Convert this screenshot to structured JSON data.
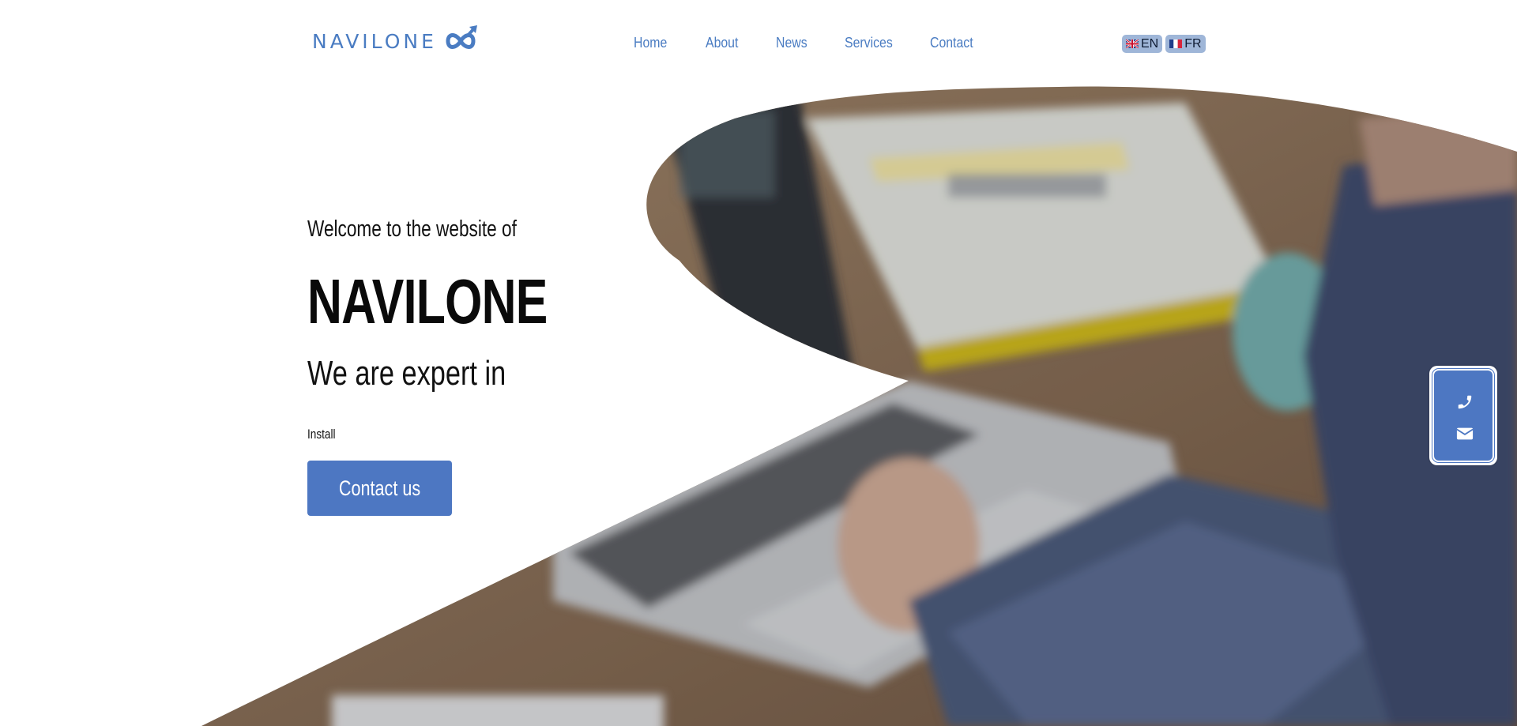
{
  "header": {
    "logo_text": "NAVILONE",
    "nav": [
      "Home",
      "About",
      "News",
      "Services",
      "Contact"
    ],
    "languages": [
      "EN",
      "FR"
    ]
  },
  "hero": {
    "welcome": "Welcome to the website of",
    "brand": "NAVILONE",
    "expert": "We are expert in",
    "typed_text": "Install",
    "cta": "Contact us"
  },
  "float_widget": {
    "icons": [
      "phone-icon",
      "envelope-icon"
    ]
  },
  "colors": {
    "accent": "#4d77c2",
    "nav": "#4a7cc2",
    "lang_bg": "#9fb6d8"
  }
}
